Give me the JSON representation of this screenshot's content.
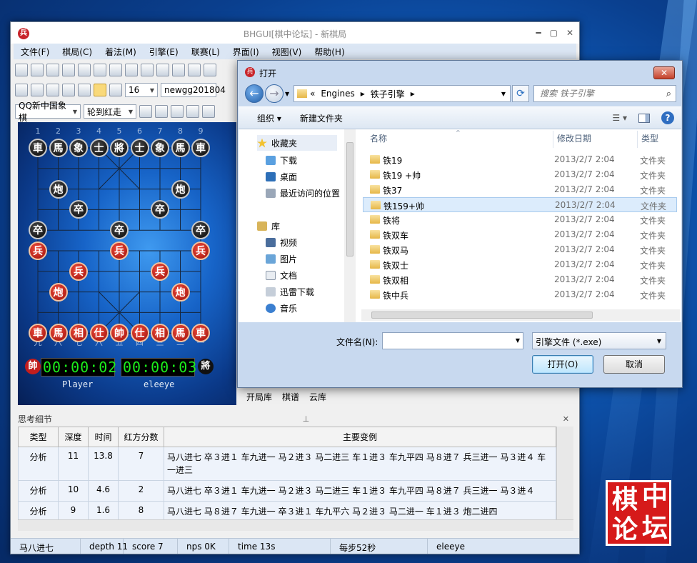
{
  "main": {
    "title": "BHGUI[棋中论坛] - 新棋局",
    "app_icon": "兵",
    "menu": [
      "文件(F)",
      "棋局(C)",
      "着法(M)",
      "引擎(E)",
      "联赛(L)",
      "界面(I)",
      "视图(V)",
      "帮助(H)"
    ],
    "toolbar": {
      "depth_value": "16",
      "engine_combo": "newgg201804",
      "ruleset_combo": "QQ新中国象棋",
      "turn_combo": "轮到红走"
    },
    "board": {
      "file_labels_top": [
        "1",
        "2",
        "3",
        "4",
        "5",
        "6",
        "7",
        "8",
        "9"
      ],
      "file_labels_bottom": [
        "九",
        "八",
        "七",
        "六",
        "五",
        "四",
        "三",
        "二",
        "一"
      ],
      "black_pieces": [
        {
          "ch": "車",
          "f": 0,
          "r": 0
        },
        {
          "ch": "馬",
          "f": 1,
          "r": 0
        },
        {
          "ch": "象",
          "f": 2,
          "r": 0
        },
        {
          "ch": "士",
          "f": 3,
          "r": 0
        },
        {
          "ch": "將",
          "f": 4,
          "r": 0
        },
        {
          "ch": "士",
          "f": 5,
          "r": 0
        },
        {
          "ch": "象",
          "f": 6,
          "r": 0
        },
        {
          "ch": "馬",
          "f": 7,
          "r": 0
        },
        {
          "ch": "車",
          "f": 8,
          "r": 0
        },
        {
          "ch": "炮",
          "f": 1,
          "r": 2
        },
        {
          "ch": "炮",
          "f": 7,
          "r": 2
        },
        {
          "ch": "卒",
          "f": 2,
          "r": 3
        },
        {
          "ch": "卒",
          "f": 6,
          "r": 3
        },
        {
          "ch": "卒",
          "f": 0,
          "r": 4
        },
        {
          "ch": "卒",
          "f": 4,
          "r": 4
        },
        {
          "ch": "卒",
          "f": 8,
          "r": 4
        }
      ],
      "red_pieces": [
        {
          "ch": "兵",
          "f": 0,
          "r": 5
        },
        {
          "ch": "兵",
          "f": 4,
          "r": 5
        },
        {
          "ch": "兵",
          "f": 8,
          "r": 5
        },
        {
          "ch": "兵",
          "f": 2,
          "r": 6
        },
        {
          "ch": "兵",
          "f": 6,
          "r": 6
        },
        {
          "ch": "炮",
          "f": 1,
          "r": 7
        },
        {
          "ch": "炮",
          "f": 7,
          "r": 7
        },
        {
          "ch": "車",
          "f": 0,
          "r": 9
        },
        {
          "ch": "馬",
          "f": 1,
          "r": 9
        },
        {
          "ch": "相",
          "f": 2,
          "r": 9
        },
        {
          "ch": "仕",
          "f": 3,
          "r": 9
        },
        {
          "ch": "帥",
          "f": 4,
          "r": 9
        },
        {
          "ch": "仕",
          "f": 5,
          "r": 9
        },
        {
          "ch": "相",
          "f": 6,
          "r": 9
        },
        {
          "ch": "馬",
          "f": 7,
          "r": 9
        },
        {
          "ch": "車",
          "f": 8,
          "r": 9
        }
      ],
      "red_side_disc": "帥",
      "black_side_disc": "將",
      "red_clock": "00:00:02",
      "black_clock": "00:00:03",
      "red_player": "Player",
      "black_player": "eleeye"
    },
    "pane_tabs": [
      "开局库",
      "棋谱",
      "云库"
    ],
    "think_panel": {
      "title": "思考细节",
      "headers": [
        "类型",
        "深度",
        "时间",
        "红方分数",
        "主要变例"
      ],
      "rows": [
        {
          "type": "分析",
          "depth": "11",
          "time": "13.8",
          "score": "7",
          "pv": "马八进七 卒３进１ 车九进一 马２进３ 马二进三 车１进３ 车九平四 马８进７ 兵三进一 马３进４ 车一进三"
        },
        {
          "type": "分析",
          "depth": "10",
          "time": "4.6",
          "score": "2",
          "pv": "马八进七 卒３进１ 车九进一 马２进３ 马二进三 车１进３ 车九平四 马８进７ 兵三进一 马３进４"
        },
        {
          "type": "分析",
          "depth": "9",
          "time": "1.6",
          "score": "8",
          "pv": "马八进七 马８进７ 车九进一 卒３进１ 车九平六 马２进３ 马二进一 车１进３ 炮二进四"
        }
      ]
    },
    "status": [
      "马八进七",
      "depth 11",
      "score 7",
      "nps 0K",
      "time 13s",
      "每步52秒",
      "eleeye"
    ]
  },
  "dialog": {
    "title": "打开",
    "address_parts": [
      "«",
      "Engines",
      "▸",
      "铁子引擎",
      "▸"
    ],
    "search_placeholder": "搜索 铁子引擎",
    "cmd_organize": "组织 ▾",
    "cmd_new_folder": "新建文件夹",
    "nav_items": [
      "收藏夹",
      "下载",
      "桌面",
      "最近访问的位置",
      "库",
      "视频",
      "图片",
      "文档",
      "迅雷下载",
      "音乐"
    ],
    "columns": [
      "名称",
      "修改日期",
      "类型"
    ],
    "files": [
      {
        "name": "铁19",
        "date": "2013/2/7 2:04",
        "type": "文件夹"
      },
      {
        "name": "铁19 +帅",
        "date": "2013/2/7 2:04",
        "type": "文件夹"
      },
      {
        "name": "铁37",
        "date": "2013/2/7 2:04",
        "type": "文件夹"
      },
      {
        "name": "铁159+帅",
        "date": "2013/2/7 2:04",
        "type": "文件夹"
      },
      {
        "name": "铁将",
        "date": "2013/2/7 2:04",
        "type": "文件夹"
      },
      {
        "name": "铁双车",
        "date": "2013/2/7 2:04",
        "type": "文件夹"
      },
      {
        "name": "铁双马",
        "date": "2013/2/7 2:04",
        "type": "文件夹"
      },
      {
        "name": "铁双士",
        "date": "2013/2/7 2:04",
        "type": "文件夹"
      },
      {
        "name": "铁双相",
        "date": "2013/2/7 2:04",
        "type": "文件夹"
      },
      {
        "name": "铁中兵",
        "date": "2013/2/7 2:04",
        "type": "文件夹"
      }
    ],
    "selected_index": 3,
    "filename_label": "文件名(N):",
    "filename_value": "",
    "filter": "引擎文件 (*.exe)",
    "open_button": "打开(O)",
    "cancel_button": "取消"
  },
  "watermark": [
    "棋",
    "中",
    "论",
    "坛"
  ]
}
